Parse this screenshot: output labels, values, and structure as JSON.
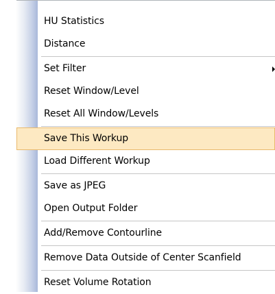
{
  "menu": {
    "groups": [
      {
        "items": [
          {
            "label": "HU Statistics"
          },
          {
            "label": "Distance"
          }
        ]
      },
      {
        "items": [
          {
            "label": "Set Filter",
            "has_submenu": true
          },
          {
            "label": "Reset Window/Level"
          },
          {
            "label": "Reset All Window/Levels"
          }
        ]
      },
      {
        "items": [
          {
            "label": "Save This Workup",
            "selected": true
          },
          {
            "label": "Load Different Workup"
          }
        ]
      },
      {
        "items": [
          {
            "label": "Save as JPEG"
          },
          {
            "label": "Open Output Folder"
          }
        ]
      },
      {
        "items": [
          {
            "label": "Add/Remove Contourline"
          }
        ]
      },
      {
        "items": [
          {
            "label": "Remove Data Outside of Center Scanfield"
          }
        ]
      },
      {
        "items": [
          {
            "label": "Reset Volume Rotation"
          }
        ]
      }
    ],
    "colors": {
      "highlight_fill": "#fde9c2",
      "highlight_border": "#e9b96b",
      "gutter": "#a8b8da",
      "separator": "#c5c5c5"
    },
    "icons": {
      "submenu": "submenu-arrow-icon"
    }
  }
}
